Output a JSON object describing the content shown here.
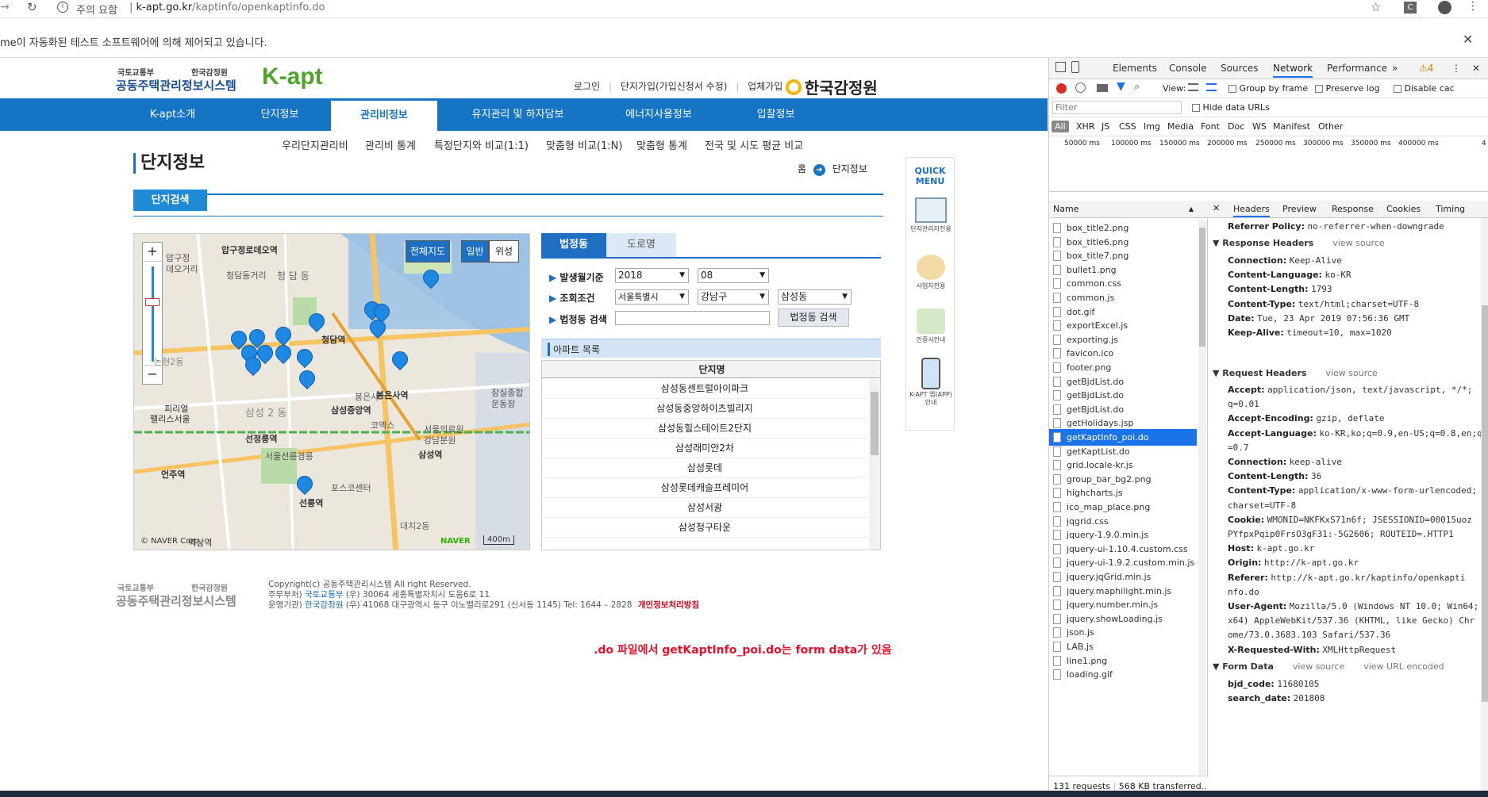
{
  "browser": {
    "security": "주의 요함",
    "url_domain": "k-apt.go.kr",
    "url_path": "/kaptinfo/openkaptinfo.do",
    "automation_msg": "me이 자동화된 테스트 소프트웨어에 의해 제어되고 있습니다."
  },
  "site": {
    "logo_ministry": "국토교통부",
    "logo_agency": "한국감정원",
    "logo_title": "공동주택관리정보시스템",
    "logo_kapt": "K-apt",
    "top_links": [
      "로그인",
      "단지가입(가입신청서 수정)",
      "업체가입"
    ],
    "brand": "한국감정원",
    "nav": [
      "K-apt소개",
      "단지정보",
      "관리비정보",
      "유지관리 및 하자담보",
      "에너지사용정보",
      "입찰정보"
    ],
    "subnav": [
      "우리단지관리비",
      "관리비 통계",
      "특정단지와 비교(1:1)",
      "맞춤형 비교(1:N)",
      "맞춤형 통계",
      "전국 및 시도 평균 비교"
    ],
    "page_title": "단지정보",
    "breadcrumb_home": "홈",
    "breadcrumb_current": "단지정보",
    "search_tab": "단지검색",
    "map": {
      "btn_full": "전체지도",
      "btn_normal": "일반",
      "btn_satellite": "위성",
      "labels": [
        "압구정로데오역",
        "압구정",
        "데오거리",
        "청담동거리",
        "청 담 동",
        "청담역",
        "삼성 2 동",
        "삼성중앙역",
        "선정릉역",
        "서울선릉경릉",
        "선릉역",
        "언주역",
        "봉은사역",
        "봉은사",
        "코엑스",
        "서울의료원",
        "강남분원",
        "삼성역",
        "포스코센터",
        "잠실종합",
        "운동장",
        "대치2동",
        "논현2동",
        "피리얼",
        "팰리스서울",
        "역삼역"
      ],
      "copyright": "© NAVER Corp.",
      "naver": "NAVER",
      "scale": "400m"
    },
    "tabs": [
      "법정동",
      "도로명"
    ],
    "form": {
      "label_date": "발생월기준",
      "year": "2018",
      "month": "08",
      "label_cond": "조회조건",
      "sido": "서울특별시",
      "gu": "강남구",
      "dong": "삼성동",
      "label_search": "법정동 검색",
      "search_btn": "법정동 검색"
    },
    "apt_list_title": "아파트 목록",
    "apt_list_header": "단지명",
    "apts": [
      "삼성동센트럴아이파크",
      "삼성동중앙하이츠빌리지",
      "삼성동힐스테이트2단지",
      "삼성래미안2차",
      "삼성롯데",
      "삼성롯데캐슬프레미어",
      "삼성서광",
      "삼성청구타운"
    ],
    "quick_menu": "QUICK MENU",
    "quick_items": [
      "단지관리자전용",
      "사업자전용",
      "인증서안내",
      "K-APT 앱(APP) 안내"
    ],
    "footer": {
      "copyright": "Copyright(c) 공동주택관리시스템 All right Reserved.",
      "line2_prefix": "주무부처)",
      "line2_link": "국토교통부",
      "line2_rest": "(우) 30064  세종특별자치시 도움6로 11",
      "line3_prefix": "운영기관)",
      "line3_link": "한국감정원",
      "line3_rest": "(우) 41068  대구광역시 동구 이노밸리로291 (신서동 1145) Tel: 1644 – 2828",
      "privacy": "개인정보처리방침"
    },
    "annotation": ".do 파일에서 getKaptInfo_poi.do는 form data가 있음"
  },
  "devtools": {
    "tabs": [
      "Elements",
      "Console",
      "Sources",
      "Network",
      "Performance"
    ],
    "warn_count": "4",
    "toolbar": {
      "view": "View:",
      "group": "Group by frame",
      "preserve": "Preserve log",
      "disable": "Disable cac"
    },
    "filter_placeholder": "Filter",
    "hide_data": "Hide data URLs",
    "types": [
      "All",
      "XHR",
      "JS",
      "CSS",
      "Img",
      "Media",
      "Font",
      "Doc",
      "WS",
      "Manifest",
      "Other"
    ],
    "timeline": [
      "50000 ms",
      "100000 ms",
      "150000 ms",
      "200000 ms",
      "250000 ms",
      "300000 ms",
      "350000 ms",
      "400000 ms",
      "4"
    ],
    "name_header": "Name",
    "files": [
      "box_title2.png",
      "box_title6.png",
      "box_title7.png",
      "bullet1.png",
      "common.css",
      "common.js",
      "dot.gif",
      "exportExcel.js",
      "exporting.js",
      "favicon.ico",
      "footer.png",
      "getBjdList.do",
      "getBjdList.do",
      "getBjdList.do",
      "getHolidays.jsp",
      "getKaptInfo_poi.do",
      "getKaptList.do",
      "grid.locale-kr.js",
      "group_bar_bg2.png",
      "highcharts.js",
      "ico_map_place.png",
      "jqgrid.css",
      "jquery-1.9.0.min.js",
      "jquery-ui-1.10.4.custom.css",
      "jquery-ui-1.9.2.custom.min.js",
      "jquery.jqGrid.min.js",
      "jquery.maphilight.min.js",
      "jquery.number.min.js",
      "jquery.showLoading.js",
      "json.js",
      "LAB.js",
      "line1.png",
      "loading.gif"
    ],
    "status": {
      "requests": "131 requests",
      "transferred": "568 KB transferred..."
    },
    "detail_tabs": [
      "Headers",
      "Preview",
      "Response",
      "Cookies",
      "Timing"
    ],
    "referrer": {
      "k": "Referrer Policy:",
      "v": "no-referrer-when-downgrade"
    },
    "resp_title": "Response Headers",
    "view_source": "view source",
    "view_url_encoded": "view URL encoded",
    "resp": [
      {
        "k": "Connection:",
        "v": "Keep-Alive"
      },
      {
        "k": "Content-Language:",
        "v": "ko-KR"
      },
      {
        "k": "Content-Length:",
        "v": "1793"
      },
      {
        "k": "Content-Type:",
        "v": "text/html;charset=UTF-8"
      },
      {
        "k": "Date:",
        "v": "Tue, 23 Apr 2019 07:56:36 GMT"
      },
      {
        "k": "Keep-Alive:",
        "v": "timeout=10, max=1020"
      }
    ],
    "req_title": "Request Headers",
    "req": [
      {
        "k": "Accept:",
        "v": "application/json, text/javascript, */*;"
      },
      {
        "k": "",
        "v": "q=0.01"
      },
      {
        "k": "Accept-Encoding:",
        "v": "gzip, deflate"
      },
      {
        "k": "Accept-Language:",
        "v": "ko-KR,ko;q=0.9,en-US;q=0.8,en;q"
      },
      {
        "k": "",
        "v": "=0.7"
      },
      {
        "k": "Connection:",
        "v": "keep-alive"
      },
      {
        "k": "Content-Length:",
        "v": "36"
      },
      {
        "k": "Content-Type:",
        "v": "application/x-www-form-urlencoded;"
      },
      {
        "k": "",
        "v": "charset=UTF-8"
      },
      {
        "k": "Cookie:",
        "v": "WMONID=NKFKxS71n6f; JSESSIONID=00015uoz"
      },
      {
        "k": "",
        "v": "PYfpxPqip0FrsO3gF31:-5G2606; ROUTEID=.HTTP1"
      },
      {
        "k": "Host:",
        "v": "k-apt.go.kr"
      },
      {
        "k": "Origin:",
        "v": "http://k-apt.go.kr"
      },
      {
        "k": "Referer:",
        "v": "http://k-apt.go.kr/kaptinfo/openkapti"
      },
      {
        "k": "",
        "v": "nfo.do"
      },
      {
        "k": "User-Agent:",
        "v": "Mozilla/5.0 (Windows NT 10.0; Win64;"
      },
      {
        "k": "",
        "v": "x64) AppleWebKit/537.36 (KHTML, like Gecko) Chr"
      },
      {
        "k": "",
        "v": "ome/73.0.3683.103 Safari/537.36"
      },
      {
        "k": "X-Requested-With:",
        "v": "XMLHttpRequest"
      }
    ],
    "form_title": "Form Data",
    "form_data": [
      {
        "k": "bjd_code:",
        "v": "11680105"
      },
      {
        "k": "search_date:",
        "v": "201808"
      }
    ]
  }
}
